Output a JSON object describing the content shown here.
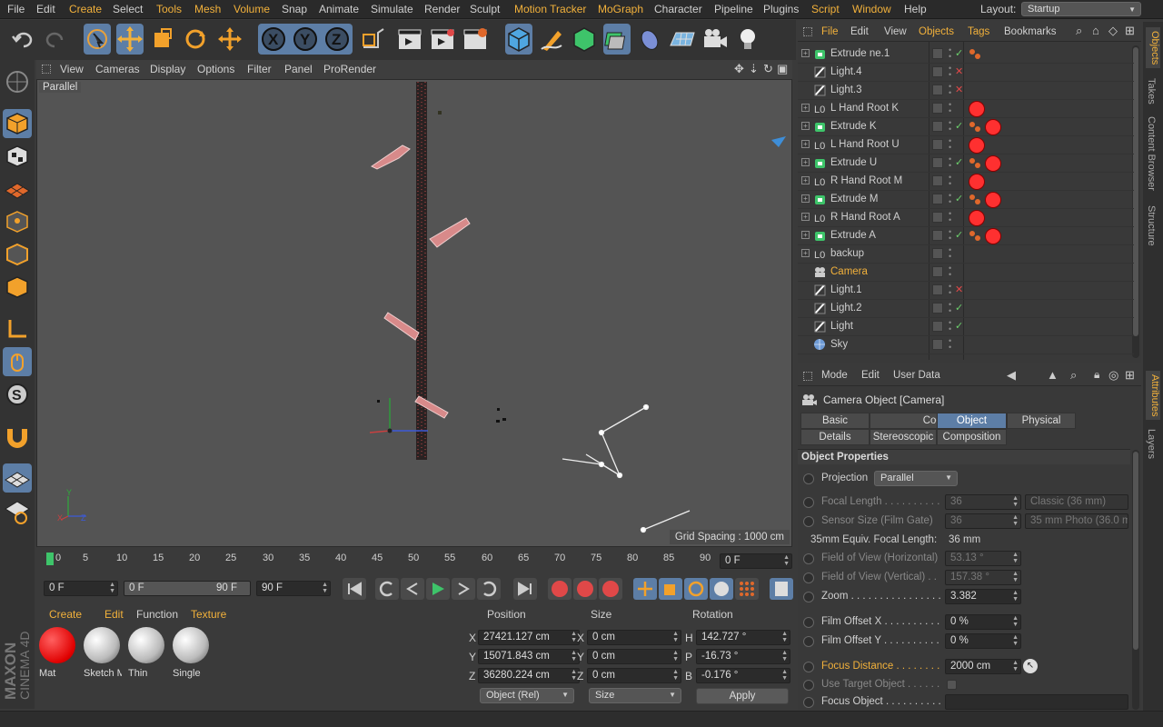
{
  "menu": {
    "items": [
      "File",
      "Edit",
      "Create",
      "Select",
      "Tools",
      "Mesh",
      "Volume",
      "Snap",
      "Animate",
      "Simulate",
      "Render",
      "Sculpt",
      "Motion Tracker",
      "MoGraph",
      "Character",
      "Pipeline",
      "Plugins",
      "Script",
      "Window",
      "Help"
    ],
    "layout_label": "Layout:",
    "layout_value": "Startup"
  },
  "viewport": {
    "menu": [
      "View",
      "Cameras",
      "Display",
      "Options",
      "Filter",
      "Panel",
      "ProRender"
    ],
    "camera_label": "Parallel",
    "grid_spacing": "Grid Spacing : 1000 cm"
  },
  "timeline": {
    "ticks": [
      "0",
      "5",
      "10",
      "15",
      "20",
      "25",
      "30",
      "35",
      "40",
      "45",
      "50",
      "55",
      "60",
      "65",
      "70",
      "75",
      "80",
      "85",
      "90"
    ],
    "current": "0 F"
  },
  "transport": {
    "start": "0 F",
    "range_start": "0 F",
    "range_end": "90 F",
    "end": "90 F"
  },
  "materials": {
    "menu": [
      "Create",
      "Edit",
      "Function",
      "Texture"
    ],
    "items": [
      {
        "name": "Mat"
      },
      {
        "name": "Sketch M"
      },
      {
        "name": "Thin"
      },
      {
        "name": "Single"
      }
    ]
  },
  "coords": {
    "headers": [
      "Position",
      "Size",
      "Rotation"
    ],
    "rows": [
      {
        "axis": "X",
        "pos": "27421.127 cm",
        "saxis": "X",
        "size": "0 cm",
        "raxis": "H",
        "rot": "142.727 °"
      },
      {
        "axis": "Y",
        "pos": "15071.843 cm",
        "saxis": "Y",
        "size": "0 cm",
        "raxis": "P",
        "rot": "-16.73 °"
      },
      {
        "axis": "Z",
        "pos": "36280.224 cm",
        "saxis": "Z",
        "size": "0 cm",
        "raxis": "B",
        "rot": "-0.176 °"
      }
    ],
    "mode": "Object (Rel)",
    "size_mode": "Size",
    "apply": "Apply"
  },
  "objects": {
    "menu": [
      "File",
      "Edit",
      "View",
      "Objects",
      "Tags",
      "Bookmarks"
    ],
    "rows": [
      {
        "name": "Extrude ne.1",
        "type": "extrude",
        "check": "✓",
        "check_color": "#6ccf6c"
      },
      {
        "name": "Light.4",
        "type": "light",
        "check": "✕",
        "check_color": "#e04848"
      },
      {
        "name": "Light.3",
        "type": "light",
        "check": "✕",
        "check_color": "#e04848"
      },
      {
        "name": "L Hand Root K",
        "type": "null",
        "check": "",
        "check_color": ""
      },
      {
        "name": "Extrude K",
        "type": "extrude",
        "check": "✓",
        "check_color": "#6ccf6c"
      },
      {
        "name": "L Hand Root U",
        "type": "null",
        "check": "",
        "check_color": ""
      },
      {
        "name": "Extrude U",
        "type": "extrude",
        "check": "✓",
        "check_color": "#6ccf6c"
      },
      {
        "name": "R Hand Root M",
        "type": "null",
        "check": "",
        "check_color": ""
      },
      {
        "name": "Extrude M",
        "type": "extrude",
        "check": "✓",
        "check_color": "#6ccf6c"
      },
      {
        "name": "R Hand Root A",
        "type": "null",
        "check": "",
        "check_color": ""
      },
      {
        "name": "Extrude A",
        "type": "extrude",
        "check": "✓",
        "check_color": "#6ccf6c"
      },
      {
        "name": "backup",
        "type": "null",
        "check": "",
        "check_color": ""
      },
      {
        "name": "Camera",
        "type": "camera",
        "check": "",
        "check_color": ""
      },
      {
        "name": "Light.1",
        "type": "light",
        "check": "✕",
        "check_color": "#e04848"
      },
      {
        "name": "Light.2",
        "type": "light",
        "check": "✓",
        "check_color": "#6ccf6c"
      },
      {
        "name": "Light",
        "type": "light",
        "check": "✓",
        "check_color": "#6ccf6c"
      },
      {
        "name": "Sky",
        "type": "sky",
        "check": "",
        "check_color": ""
      }
    ]
  },
  "attributes": {
    "menu": [
      "Mode",
      "Edit",
      "User Data"
    ],
    "title": "Camera Object [Camera]",
    "tabs_row1": [
      "Basic",
      "Coord.",
      "Object",
      "Physical"
    ],
    "tabs_row2": [
      "Details",
      "Stereoscopic",
      "Composition"
    ],
    "section": "Object Properties",
    "props": [
      {
        "label": "Projection",
        "value": "Parallel",
        "kind": "select"
      },
      {
        "label": "Focal Length . . . . . . . . . .",
        "value": "36",
        "extra": "Classic (36 mm)",
        "kind": "dim"
      },
      {
        "label": "Sensor Size (Film Gate)",
        "value": "36",
        "extra": "35 mm Photo (36.0 m",
        "kind": "dim"
      },
      {
        "label": "35mm Equiv. Focal Length:",
        "value": "36 mm",
        "kind": "text"
      },
      {
        "label": "Field of View (Horizontal)",
        "value": "53.13 °",
        "kind": "dim"
      },
      {
        "label": "Field of View (Vertical) . .",
        "value": "157.38 °",
        "kind": "dim"
      },
      {
        "label": "Zoom . . . . . . . . . . . . . . . .",
        "value": "3.382",
        "kind": "field"
      },
      {
        "label": "Film Offset X . . . . . . . . . .",
        "value": "0 %",
        "kind": "field"
      },
      {
        "label": "Film Offset Y . . . . . . . . . .",
        "value": "0 %",
        "kind": "field"
      },
      {
        "label": "Focus Distance . . . . . . . .",
        "value": "2000 cm",
        "kind": "focus"
      },
      {
        "label": "Use Target Object . . . . . .",
        "value": "",
        "kind": "check"
      },
      {
        "label": "Focus Object . . . . . . . . . .",
        "value": "",
        "kind": "empty"
      }
    ]
  },
  "dock": {
    "top": [
      "Objects",
      "Takes",
      "Content Browser",
      "Structure"
    ],
    "bottom": [
      "Attributes",
      "Layers"
    ]
  },
  "brand": {
    "line1": "MAXON",
    "line2": "CINEMA 4D"
  },
  "colors": {
    "accent": "#f2b13b",
    "active": "#5d7ea6",
    "material_red": "#ff2a2a"
  }
}
